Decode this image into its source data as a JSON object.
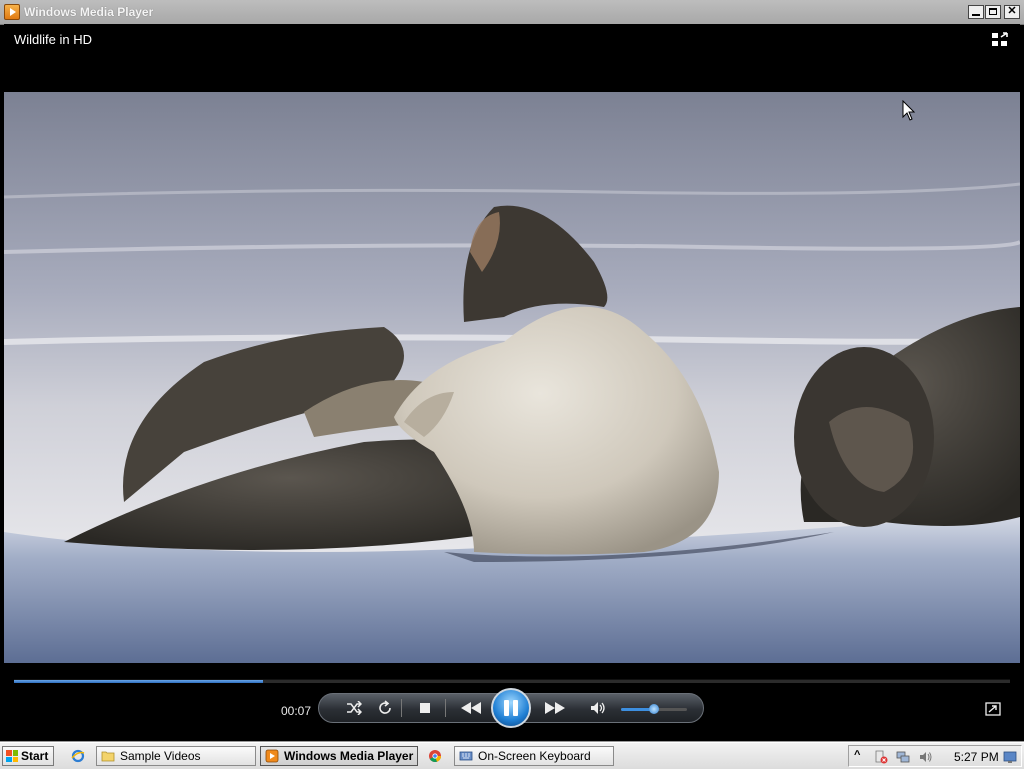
{
  "window": {
    "title": "Windows Media Player",
    "buttons": [
      "minimize",
      "maximize",
      "close"
    ]
  },
  "player": {
    "now_playing": "Wildlife in HD",
    "elapsed": "00:07",
    "seek_progress": 0.25,
    "volume_level": 0.5,
    "controls": [
      "shuffle-icon",
      "repeat-icon",
      "stop-icon",
      "rewind-icon",
      "pause-icon",
      "fast-forward-icon",
      "volume-icon"
    ],
    "accent_color": "#2e6fc0"
  },
  "taskbar": {
    "start_label": "Start",
    "items": [
      {
        "label": "",
        "icon": "ie-icon"
      },
      {
        "label": "Sample Videos",
        "icon": "folder-icon"
      },
      {
        "label": "Windows Media Player",
        "icon": "media-player-icon",
        "active": true
      },
      {
        "label": "",
        "icon": "chrome-icon"
      },
      {
        "label": "On-Screen Keyboard",
        "icon": "keyboard-icon"
      }
    ],
    "clock": "5:27 PM"
  }
}
